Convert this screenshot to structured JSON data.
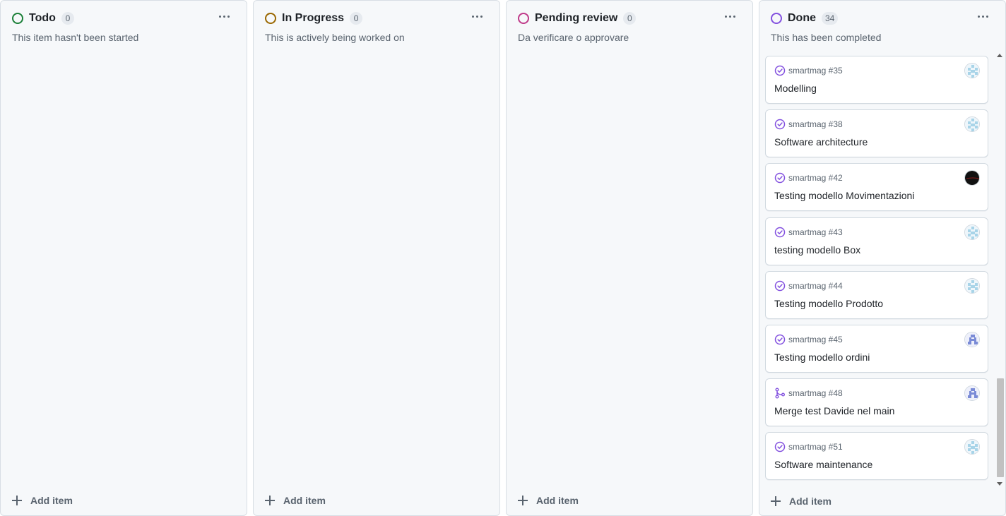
{
  "colors": {
    "todo": "#1a7f37",
    "in_progress": "#9a6700",
    "pending_review": "#bf3989",
    "done": "#8250df"
  },
  "columns": [
    {
      "title": "Todo",
      "count": "0",
      "description": "This item hasn't been started",
      "status_icon": "circle-green-icon",
      "add_label": "Add item"
    },
    {
      "title": "In Progress",
      "count": "0",
      "description": "This is actively being worked on",
      "status_icon": "circle-yellow-icon",
      "add_label": "Add item"
    },
    {
      "title": "Pending review",
      "count": "0",
      "description": "Da verificare o approvare",
      "status_icon": "circle-pink-icon",
      "add_label": "Add item"
    },
    {
      "title": "Done",
      "count": "34",
      "description": "This has been completed",
      "status_icon": "circle-purple-icon",
      "add_label": "Add item"
    }
  ],
  "done_cards": [
    {
      "ref": "smartmag #35",
      "title": "Modelling",
      "state_icon": "issue-closed-icon",
      "avatar": "identicon-avatar"
    },
    {
      "ref": "smartmag #38",
      "title": "Software architecture",
      "state_icon": "issue-closed-icon",
      "avatar": "identicon-avatar"
    },
    {
      "ref": "smartmag #42",
      "title": "Testing modello Movimentazioni",
      "state_icon": "issue-closed-icon",
      "avatar": "dark-avatar"
    },
    {
      "ref": "smartmag #43",
      "title": "testing modello Box",
      "state_icon": "issue-closed-icon",
      "avatar": "identicon-avatar"
    },
    {
      "ref": "smartmag #44",
      "title": "Testing modello Prodotto",
      "state_icon": "issue-closed-icon",
      "avatar": "identicon-avatar"
    },
    {
      "ref": "smartmag #45",
      "title": "Testing modello ordini",
      "state_icon": "issue-closed-icon",
      "avatar": "identicon-blue-avatar"
    },
    {
      "ref": "smartmag #48",
      "title": "Merge test Davide nel main",
      "state_icon": "pull-request-merged-icon",
      "avatar": "identicon-blue-avatar"
    },
    {
      "ref": "smartmag #51",
      "title": "Software maintenance",
      "state_icon": "issue-closed-icon",
      "avatar": "identicon-avatar"
    }
  ]
}
